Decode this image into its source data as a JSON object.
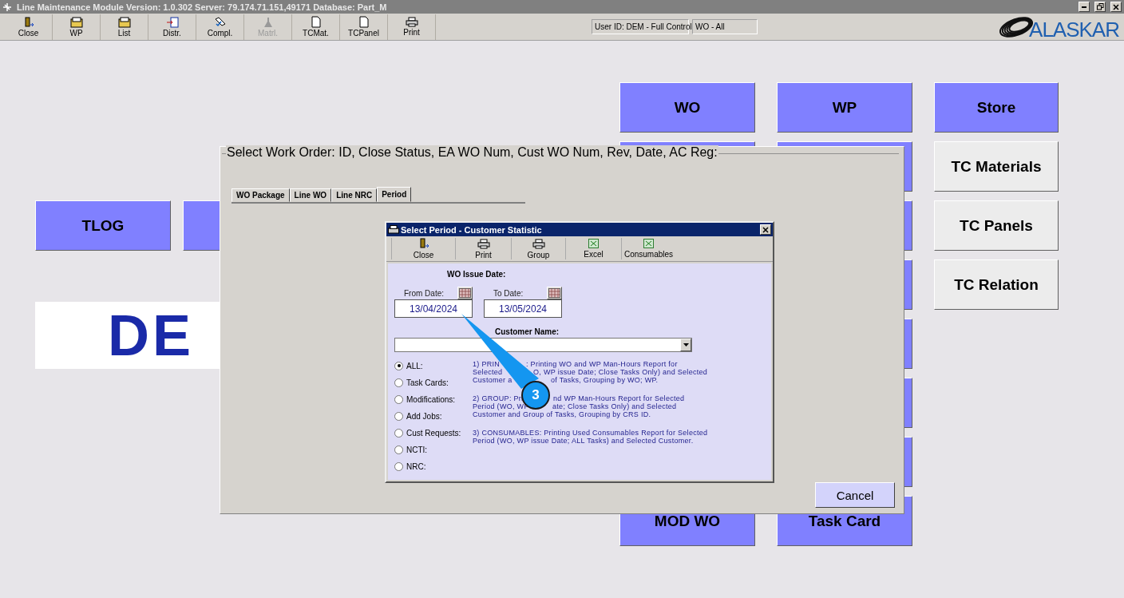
{
  "window": {
    "title": "Line Maintenance Module  Version: 1.0.302 Server: 79.174.71.151,49171 Database: Part_M"
  },
  "toolbar": [
    {
      "label": "Close",
      "kind": "exit",
      "disabled": false
    },
    {
      "label": "WP",
      "kind": "folder",
      "disabled": false
    },
    {
      "label": "List",
      "kind": "folder",
      "disabled": false
    },
    {
      "label": "Distr.",
      "kind": "export",
      "disabled": false
    },
    {
      "label": "Compl.",
      "kind": "tick",
      "disabled": false
    },
    {
      "label": "Matrl.",
      "kind": "flask",
      "disabled": true
    },
    {
      "label": "TCMat.",
      "kind": "document",
      "disabled": false
    },
    {
      "label": "TCPanel",
      "kind": "document",
      "disabled": false
    },
    {
      "label": "Print",
      "kind": "printer",
      "disabled": false
    }
  ],
  "status": [
    "User ID: DEM - Full Control",
    "WO - All"
  ],
  "logo_text": "ALASKAR",
  "left_button": "TLOG",
  "banner_text": "DE",
  "menu_columns": [
    {
      "top": "WO",
      "bottom": "MOD WO"
    },
    {
      "top": "WP",
      "bottom": "Task Card"
    }
  ],
  "side_buttons": [
    "Store",
    "TC Materials",
    "TC Panels",
    "TC Relation"
  ],
  "work_order_dialog": {
    "title": "Select Work Order: ID, Close Status, EA WO Num, Cust WO Num, Rev, Date, AC Reg:",
    "tabs": [
      {
        "label": "WO Package",
        "selected": false
      },
      {
        "label": "Line WO",
        "selected": false
      },
      {
        "label": "Line NRC",
        "selected": false
      },
      {
        "label": "Period",
        "selected": true
      }
    ],
    "cancel": "Cancel"
  },
  "period_dialog": {
    "title": "Select Period - Customer Statistic",
    "toolbar": [
      {
        "label": "Close",
        "kind": "exit"
      },
      {
        "label": "Print",
        "kind": "printer"
      },
      {
        "label": "Group",
        "kind": "printer"
      },
      {
        "label": "Excel",
        "kind": "sheet"
      },
      {
        "label": "Consumables",
        "kind": "sheet"
      }
    ],
    "section_title": "WO Issue Date:",
    "from_label": "From Date:",
    "from_value": "13/04/2024",
    "to_label": "To Date:",
    "to_value": "13/05/2024",
    "customer_label": "Customer Name:",
    "options": [
      {
        "label": "ALL:",
        "selected": true
      },
      {
        "label": "Task Cards:",
        "selected": false
      },
      {
        "label": "Modifications:",
        "selected": false
      },
      {
        "label": "Add Jobs:",
        "selected": false
      },
      {
        "label": "Cust Requests:",
        "selected": false
      },
      {
        "label": "NCTI:",
        "selected": false
      },
      {
        "label": "NRC:",
        "selected": false
      }
    ],
    "notes": [
      {
        "lines": [
          [
            "1) PRIN",
            ": Printing WO and WP Man-Hours Report for"
          ],
          [
            "Selected",
            "O, WP issue Date; Close Tasks Only) and Selected"
          ],
          [
            "Customer a",
            "of Tasks, Grouping by WO; WP."
          ]
        ]
      },
      {
        "lines": [
          [
            "2) GROUP: Pri",
            "nd WP Man-Hours Report for Selected"
          ],
          [
            "Period (WO, WP",
            "ate; Close Tasks Only) and Selected"
          ],
          [
            "Customer and Group of Tasks, Grouping by CRS ID."
          ]
        ]
      },
      {
        "lines": [
          [
            "3) CONSUMABLES: Printing Used Consumables Report for Selected"
          ],
          [
            "Period (WO, WP issue Date; ALL Tasks) and Selected Customer."
          ]
        ]
      }
    ]
  },
  "callout": {
    "text": "3"
  }
}
